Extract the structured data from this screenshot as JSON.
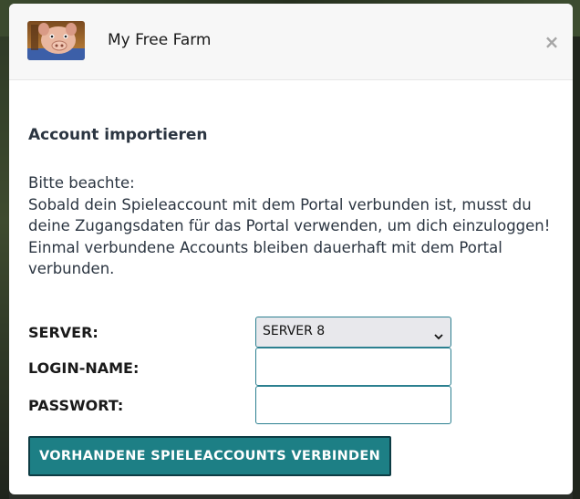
{
  "header": {
    "app_title": "My Free Farm",
    "close_symbol": "×"
  },
  "content": {
    "heading": "Account importieren",
    "notice_title": "Bitte beachte:",
    "notice_line1": "Sobald dein Spieleaccount mit dem Portal verbunden ist, musst du deine Zugangsdaten für das Portal verwenden, um dich einzuloggen!",
    "notice_line2": "Einmal verbundene Accounts bleiben dauerhaft mit dem Portal verbunden."
  },
  "form": {
    "server_label": "SERVER:",
    "server_value": "SERVER 8",
    "login_label": "LOGIN-NAME:",
    "login_value": "",
    "password_label": "PASSWORT:",
    "password_value": "",
    "submit_label": "VORHANDENE SPIELEACCOUNTS VERBINDEN"
  },
  "colors": {
    "accent": "#1d7f85",
    "input_border": "#2c8090",
    "text": "#2b3541"
  }
}
